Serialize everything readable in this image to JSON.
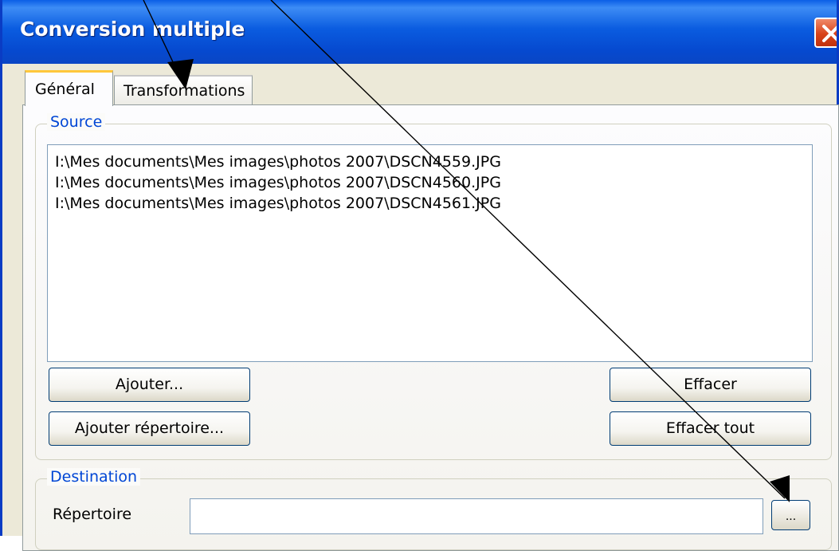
{
  "window": {
    "title": "Conversion multiple"
  },
  "tabs": [
    {
      "label": "Général",
      "active": true
    },
    {
      "label": "Transformations",
      "active": false
    }
  ],
  "source": {
    "legend": "Source",
    "files": [
      "I:\\Mes documents\\Mes images\\photos 2007\\DSCN4559.JPG",
      "I:\\Mes documents\\Mes images\\photos 2007\\DSCN4560.JPG",
      "I:\\Mes documents\\Mes images\\photos 2007\\DSCN4561.JPG"
    ],
    "buttons": {
      "add": "Ajouter...",
      "add_directory": "Ajouter répertoire...",
      "clear": "Effacer",
      "clear_all": "Effacer tout"
    }
  },
  "destination": {
    "legend": "Destination",
    "directory_label": "Répertoire",
    "directory_value": "",
    "browse_label": "..."
  }
}
